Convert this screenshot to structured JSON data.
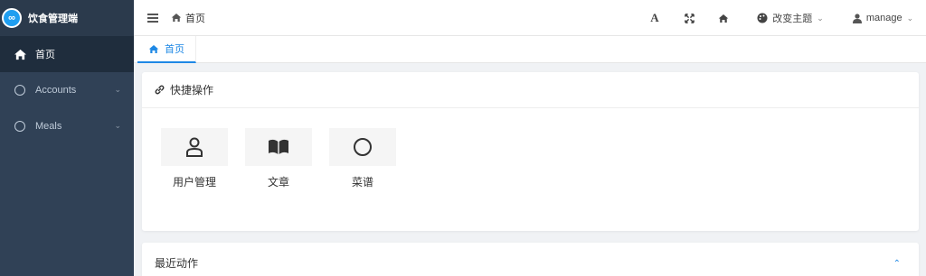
{
  "app": {
    "title": "饮食管理端",
    "logo_text": "∞"
  },
  "sidebar": {
    "items": [
      {
        "label": "首页",
        "active": true,
        "icon": "home-icon"
      },
      {
        "label": "Accounts",
        "icon": "circle-icon",
        "has_submenu": true
      },
      {
        "label": "Meals",
        "icon": "circle-icon",
        "has_submenu": true
      }
    ]
  },
  "header": {
    "breadcrumb": "首页",
    "theme_label": "改变主题",
    "user_label": "manage",
    "font_button": "A"
  },
  "tabs": [
    {
      "label": "首页",
      "active": true
    }
  ],
  "quick_actions": {
    "title": "快捷操作",
    "items": [
      {
        "label": "用户管理",
        "icon": "user-icon"
      },
      {
        "label": "文章",
        "icon": "book-icon"
      },
      {
        "label": "菜谱",
        "icon": "circle-icon"
      }
    ]
  },
  "recent": {
    "title": "最近动作"
  },
  "colors": {
    "sidebar_bg": "#304156",
    "accent": "#1e88e5",
    "logo": "#1f9ef0"
  }
}
